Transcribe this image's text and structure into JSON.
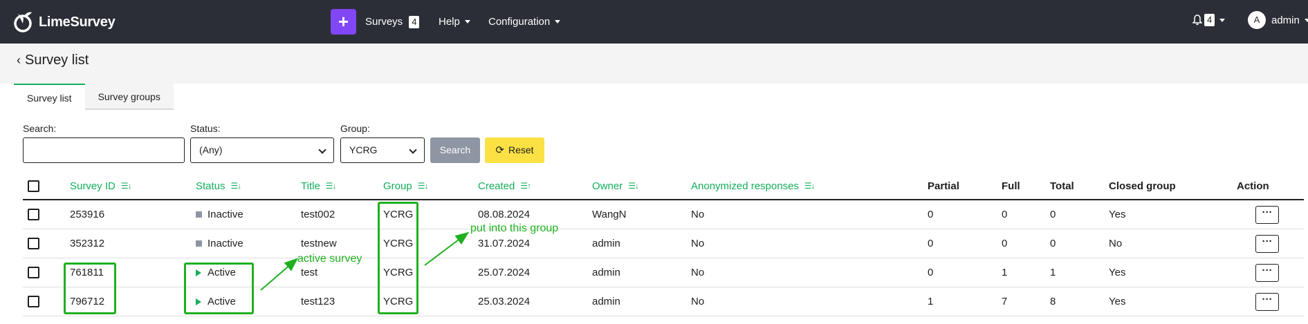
{
  "header": {
    "logo_text": "LimeSurvey",
    "plus_symbol": "+",
    "nav": [
      {
        "label": "Surveys",
        "badge": "4"
      },
      {
        "label": "Help"
      },
      {
        "label": "Configuration"
      }
    ],
    "notifications_count": "4",
    "user_initial": "A",
    "user_name": "admin"
  },
  "page": {
    "back_symbol": "‹",
    "title": "Survey list"
  },
  "tabs": [
    {
      "label": "Survey list",
      "active": true
    },
    {
      "label": "Survey groups",
      "active": false
    }
  ],
  "filters": {
    "search_label": "Search:",
    "search_value": "",
    "status_label": "Status:",
    "status_value": "(Any)",
    "group_label": "Group:",
    "group_value": "YCRG",
    "search_button": "Search",
    "reset_button": "Reset"
  },
  "table": {
    "columns": {
      "survey_id": "Survey ID",
      "status": "Status",
      "title": "Title",
      "group": "Group",
      "created": "Created",
      "owner": "Owner",
      "anonymized": "Anonymized responses",
      "partial": "Partial",
      "full": "Full",
      "total": "Total",
      "closed_group": "Closed group",
      "action": "Action"
    },
    "sort_glyph_desc": "☰↓",
    "sort_glyph_asc": "☰↑",
    "action_glyph": "···",
    "rows": [
      {
        "survey_id": "253916",
        "status": "Inactive",
        "title": "test002",
        "group": "YCRG",
        "created": "08.08.2024",
        "owner": "WangN",
        "anonymized": "No",
        "partial": "0",
        "full": "0",
        "total": "0",
        "closed_group": "Yes"
      },
      {
        "survey_id": "352312",
        "status": "Inactive",
        "title": "testnew",
        "group": "YCRG",
        "created": "31.07.2024",
        "owner": "admin",
        "anonymized": "No",
        "partial": "0",
        "full": "0",
        "total": "0",
        "closed_group": "No"
      },
      {
        "survey_id": "761811",
        "status": "Active",
        "title": "test",
        "group": "YCRG",
        "created": "25.07.2024",
        "owner": "admin",
        "anonymized": "No",
        "partial": "0",
        "full": "1",
        "total": "1",
        "closed_group": "Yes"
      },
      {
        "survey_id": "796712",
        "status": "Active",
        "title": "test123",
        "group": "YCRG",
        "created": "25.03.2024",
        "owner": "admin",
        "anonymized": "No",
        "partial": "1",
        "full": "7",
        "total": "8",
        "closed_group": "Yes"
      }
    ]
  },
  "annotations": {
    "active_survey": "active survey",
    "put_into_group": "put into this group",
    "color": "#1fb01f"
  },
  "colors": {
    "topbar": "#2b2e36",
    "accent_purple": "#8146f6",
    "accent_green": "#14ae5c",
    "reset_yellow": "#fbe144",
    "search_gray": "#8e95a3"
  }
}
